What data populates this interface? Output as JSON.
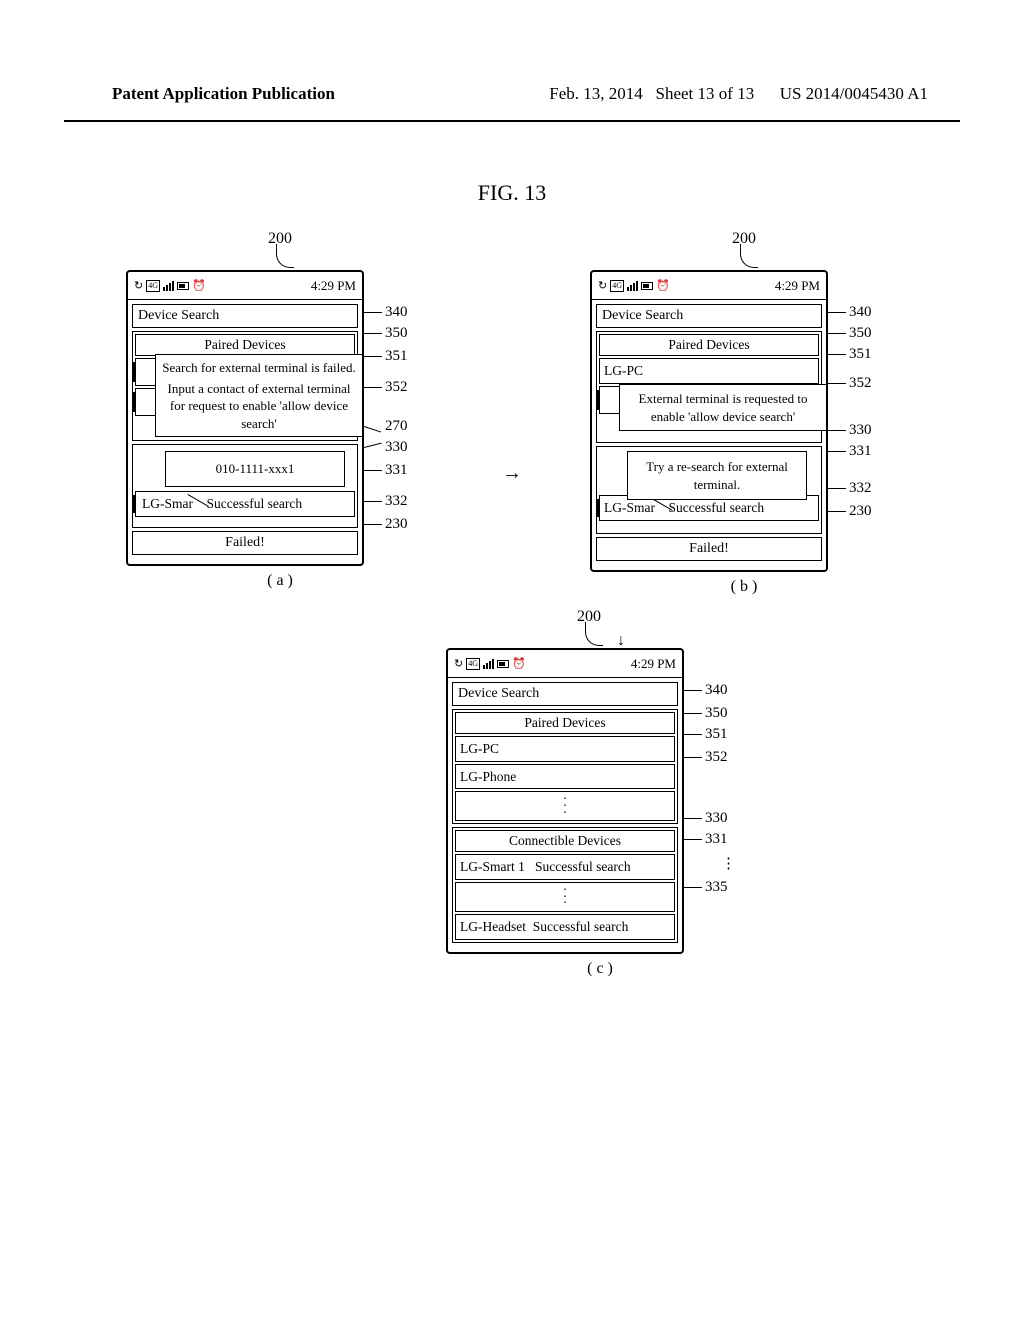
{
  "header": {
    "left": "Patent Application Publication",
    "date": "Feb. 13, 2014",
    "sheet": "Sheet 13 of 13",
    "pubno": "US 2014/0045430 A1"
  },
  "figure_title": "FIG. 13",
  "ref200": "200",
  "status": {
    "time": "4:29 PM",
    "net": "4G"
  },
  "screens": {
    "a": {
      "label": "( a )",
      "device_search": "Device Search",
      "paired_header": "Paired Devices",
      "popup_msg1": "Search for external terminal is failed.",
      "popup_msg2": "Input a contact of external terminal for request to enable 'allow device search'",
      "input_value": "010-1111-xxx1",
      "row_device": "LG-Smar",
      "row_status": "Successful search",
      "footer": "Failed!",
      "leaders": [
        "340",
        "350",
        "351",
        "352",
        "270",
        "330",
        "331",
        "332",
        "230"
      ]
    },
    "b": {
      "label": "( b )",
      "device_search": "Device Search",
      "paired_header": "Paired Devices",
      "item1": "LG-PC",
      "popup_msg": "External terminal is requested to enable 'allow device search'",
      "retry_msg": "Try a re-search for external terminal.",
      "row_device": "LG-Smar",
      "row_status": "Successful search",
      "footer": "Failed!",
      "leaders": [
        "340",
        "350",
        "351",
        "352",
        "330",
        "331",
        "332",
        "230"
      ]
    },
    "c": {
      "label": "( c )",
      "device_search": "Device Search",
      "paired_header": "Paired Devices",
      "item1": "LG-PC",
      "item2": "LG-Phone",
      "conn_header": "Connectible Devices",
      "row1_device": "LG-Smart 1",
      "row1_status": "Successful search",
      "row_last_device": "LG-Headset",
      "row_last_status": "Successful search",
      "leaders": [
        "340",
        "350",
        "351",
        "352",
        "330",
        "331",
        "335"
      ],
      "vdots": "⋮"
    }
  }
}
